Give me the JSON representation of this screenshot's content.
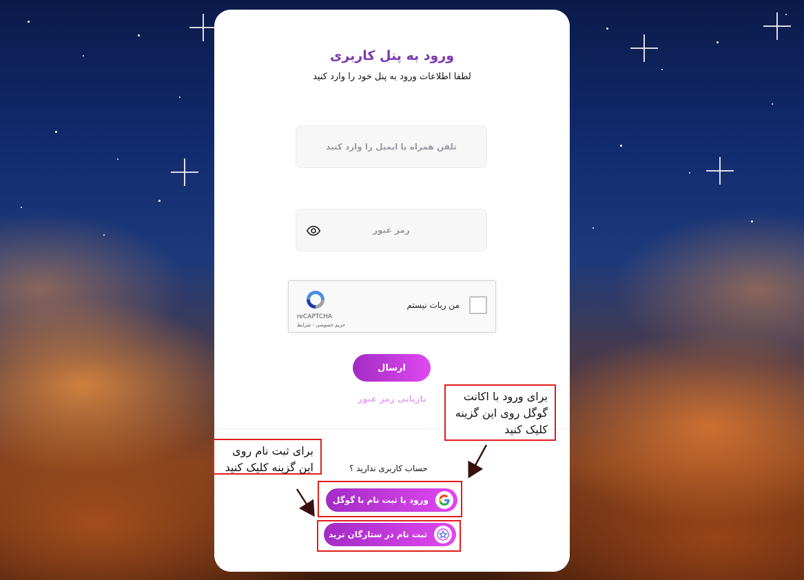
{
  "login": {
    "title": "ورود به پنل کاربری",
    "subtitle": "لطفا اطلاعات ورود به پنل خود را وارد کنید",
    "phone_placeholder": "تلفن همراه یا ایمیل را وارد کنید",
    "password_placeholder": "رمز عبور",
    "submit_label": "ارسال",
    "forgot_label": "بازیابی رمز عبور",
    "no_account": "حساب کاربری ندارید ؟"
  },
  "captcha": {
    "label": "من ربات نیستم",
    "brand": "reCAPTCHA",
    "terms": "حریم خصوصی - شرایط"
  },
  "social": {
    "google_label": "ورود یا ثبت نام با گوگل",
    "register_label": "ثبت نام در ستارگان ترید"
  },
  "annotations": {
    "google_note": "برای ورود با اکانت گوگل روی این گزینه کلیک کنید",
    "register_note": "برای ثبت نام روی این گزینه کلیک کنید",
    "highlight_color": "#e21b1b"
  },
  "icons": {
    "password_toggle": "eye-icon",
    "google": "google-icon",
    "register": "star-logo-icon",
    "captcha": "recaptcha-icon"
  },
  "colors": {
    "accent": "#7c3aad",
    "button_gradient_start": "#a32cc4",
    "button_gradient_end": "#e048f0",
    "forgot_link": "#e2a6f0"
  }
}
